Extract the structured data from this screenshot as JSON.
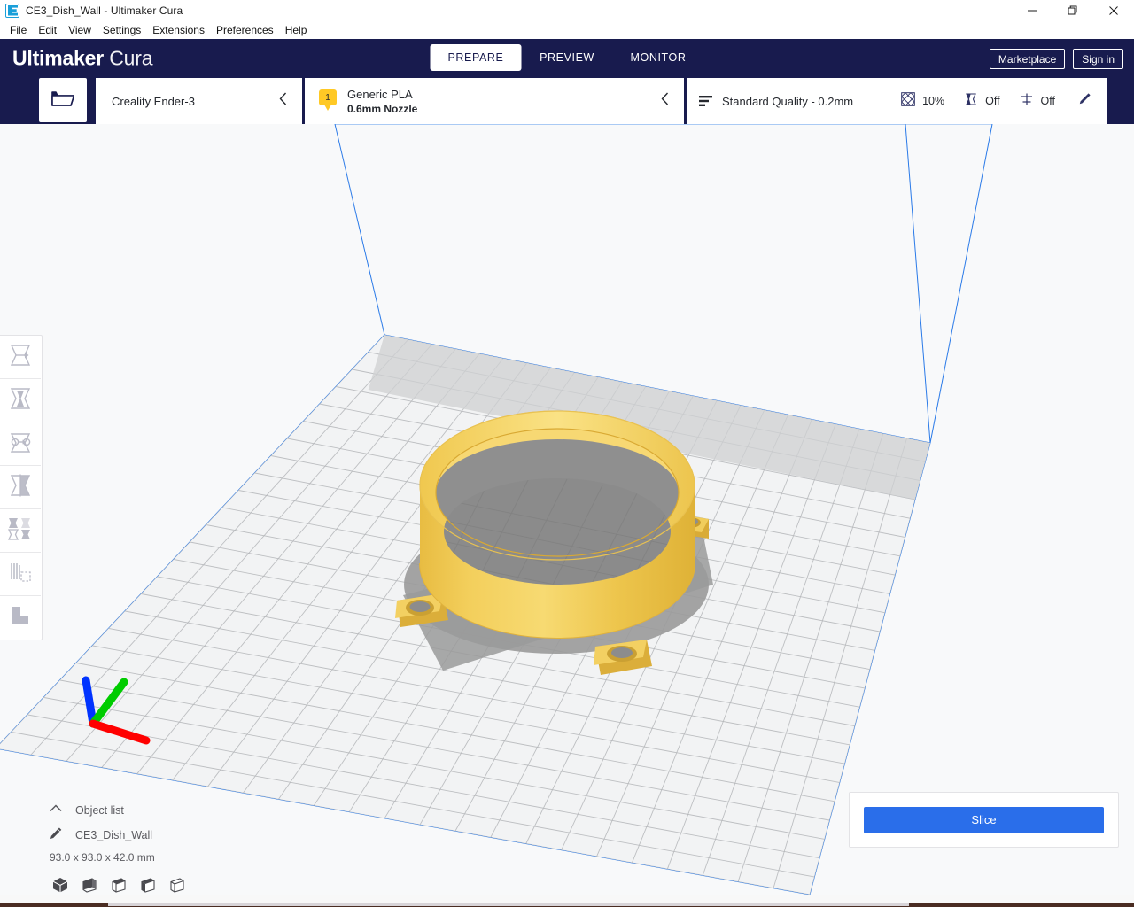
{
  "window": {
    "title": "CE3_Dish_Wall - Ultimaker Cura",
    "app_icon": "cura-logo-icon",
    "controls": {
      "minimize": "minimize-icon",
      "maximize": "restore-icon",
      "close": "close-icon"
    }
  },
  "menubar": {
    "items": [
      {
        "label": "File",
        "accel": "F"
      },
      {
        "label": "Edit",
        "accel": "E"
      },
      {
        "label": "View",
        "accel": "V"
      },
      {
        "label": "Settings",
        "accel": "S"
      },
      {
        "label": "Extensions",
        "accel": "x"
      },
      {
        "label": "Preferences",
        "accel": "P"
      },
      {
        "label": "Help",
        "accel": "H"
      }
    ]
  },
  "header": {
    "brand_bold": "Ultimaker",
    "brand_light": "Cura",
    "stages": [
      {
        "label": "PREPARE",
        "active": true
      },
      {
        "label": "PREVIEW",
        "active": false
      },
      {
        "label": "MONITOR",
        "active": false
      }
    ],
    "marketplace_label": "Marketplace",
    "signin_label": "Sign in",
    "background_color": "#181b4e"
  },
  "configbar": {
    "open_file_icon": "open-folder-icon",
    "printer": {
      "name": "Creality Ender-3",
      "chevron": "chevron-left-icon"
    },
    "material": {
      "extruder_number": "1",
      "name": "Generic PLA",
      "nozzle": "0.6mm Nozzle",
      "chevron": "chevron-left-icon",
      "badge_color": "#ffc925"
    },
    "quality": {
      "profile_icon": "layer-height-icon",
      "profile": "Standard Quality - 0.2mm",
      "stats": [
        {
          "icon": "infill-icon",
          "value": "10%"
        },
        {
          "icon": "support-icon",
          "value": "Off"
        },
        {
          "icon": "adhesion-icon",
          "value": "Off"
        }
      ],
      "edit_icon": "pencil-icon"
    }
  },
  "toolbar": {
    "tools": [
      {
        "name": "move-tool",
        "icon": "move-icon"
      },
      {
        "name": "scale-tool",
        "icon": "scale-icon"
      },
      {
        "name": "rotate-tool",
        "icon": "rotate-icon"
      },
      {
        "name": "mirror-tool",
        "icon": "mirror-icon"
      },
      {
        "name": "per-model-settings-tool",
        "icon": "per-model-settings-icon"
      },
      {
        "name": "support-blocker-tool",
        "icon": "support-blocker-icon"
      },
      {
        "name": "custom-supports-tool",
        "icon": "custom-supports-icon"
      }
    ]
  },
  "objectlist": {
    "collapse_icon": "chevron-up-icon",
    "title": "Object list",
    "item_icon": "pencil-icon",
    "item_name": "CE3_Dish_Wall",
    "dimensions": "93.0 x 93.0 x 42.0 mm",
    "view_cubes": [
      "view-3d-icon",
      "view-front-icon",
      "view-top-icon",
      "view-left-icon",
      "view-right-icon"
    ]
  },
  "slice_panel": {
    "button_label": "Slice",
    "button_color": "#2a6eea"
  },
  "viewport": {
    "background_color": "#f8f9fa",
    "buildplate_color": "#f2f3f4",
    "grid_color": "#b4b6b9",
    "volume_line_color": "#2a7ae8",
    "model_color": "#f0c850",
    "shadow_color": "#9a9a9a",
    "axes": {
      "x_color": "#ff0000",
      "y_color": "#00cc00",
      "z_color": "#0033ff"
    }
  }
}
